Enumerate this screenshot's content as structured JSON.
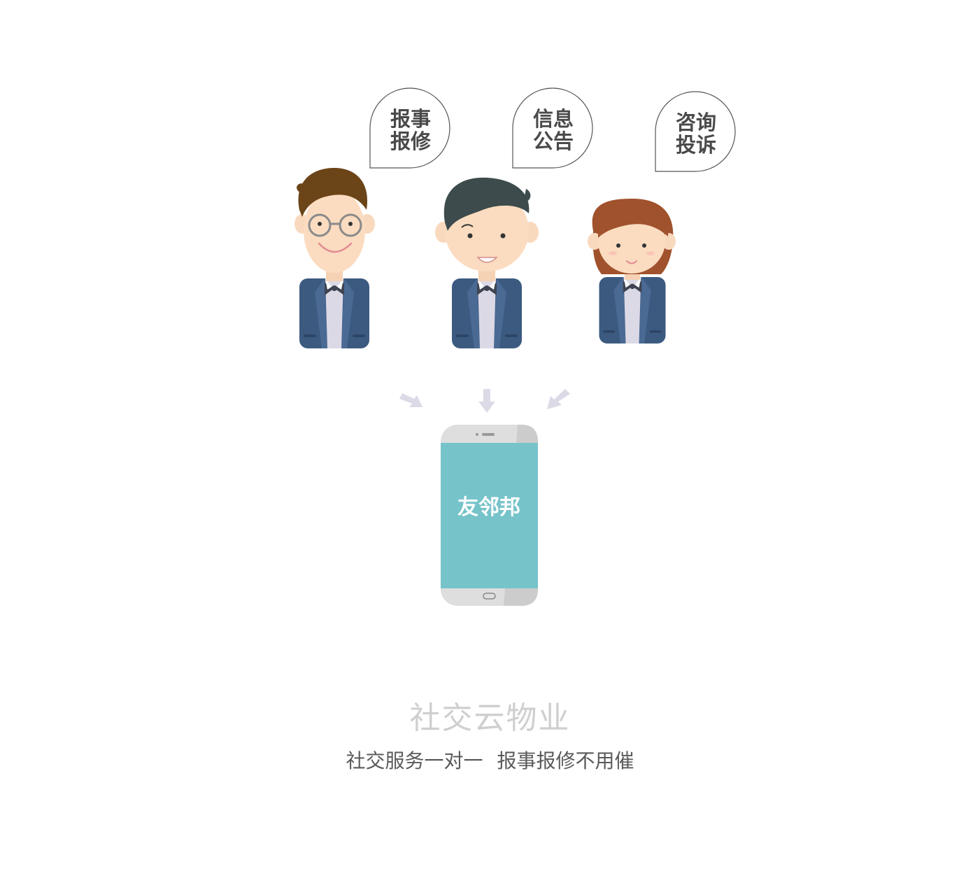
{
  "bubbles": [
    {
      "line1": "报事",
      "line2": "报修"
    },
    {
      "line1": "信息",
      "line2": "公告"
    },
    {
      "line1": "咨询",
      "line2": "投诉"
    }
  ],
  "phone": {
    "app_name": "友邻邦"
  },
  "caption": {
    "title": "社交云物业",
    "subtitle_part1": "社交服务一对一",
    "subtitle_part2": "报事报修不用催"
  },
  "colors": {
    "screen": "#76c3ca",
    "suit": "#3c5a80",
    "arrow": "#dcdae6",
    "bubble_stroke": "#555555",
    "bubble_text": "#4a4a4a",
    "caption_title": "#cfcfcf",
    "caption_sub": "#5a5a5a"
  }
}
